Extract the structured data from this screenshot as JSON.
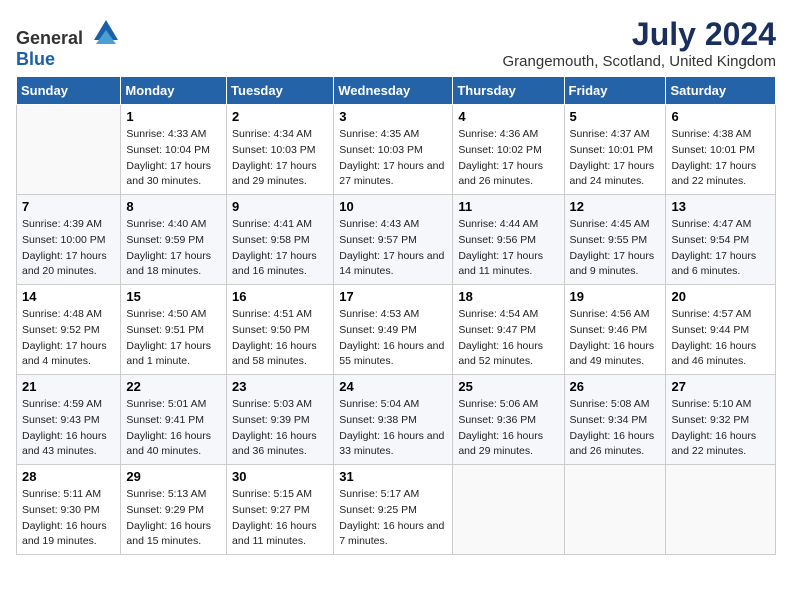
{
  "logo": {
    "general": "General",
    "blue": "Blue"
  },
  "title": "July 2024",
  "location": "Grangemouth, Scotland, United Kingdom",
  "headers": [
    "Sunday",
    "Monday",
    "Tuesday",
    "Wednesday",
    "Thursday",
    "Friday",
    "Saturday"
  ],
  "weeks": [
    [
      {
        "day": "",
        "sunrise": "",
        "sunset": "",
        "daylight": ""
      },
      {
        "day": "1",
        "sunrise": "Sunrise: 4:33 AM",
        "sunset": "Sunset: 10:04 PM",
        "daylight": "Daylight: 17 hours and 30 minutes."
      },
      {
        "day": "2",
        "sunrise": "Sunrise: 4:34 AM",
        "sunset": "Sunset: 10:03 PM",
        "daylight": "Daylight: 17 hours and 29 minutes."
      },
      {
        "day": "3",
        "sunrise": "Sunrise: 4:35 AM",
        "sunset": "Sunset: 10:03 PM",
        "daylight": "Daylight: 17 hours and 27 minutes."
      },
      {
        "day": "4",
        "sunrise": "Sunrise: 4:36 AM",
        "sunset": "Sunset: 10:02 PM",
        "daylight": "Daylight: 17 hours and 26 minutes."
      },
      {
        "day": "5",
        "sunrise": "Sunrise: 4:37 AM",
        "sunset": "Sunset: 10:01 PM",
        "daylight": "Daylight: 17 hours and 24 minutes."
      },
      {
        "day": "6",
        "sunrise": "Sunrise: 4:38 AM",
        "sunset": "Sunset: 10:01 PM",
        "daylight": "Daylight: 17 hours and 22 minutes."
      }
    ],
    [
      {
        "day": "7",
        "sunrise": "Sunrise: 4:39 AM",
        "sunset": "Sunset: 10:00 PM",
        "daylight": "Daylight: 17 hours and 20 minutes."
      },
      {
        "day": "8",
        "sunrise": "Sunrise: 4:40 AM",
        "sunset": "Sunset: 9:59 PM",
        "daylight": "Daylight: 17 hours and 18 minutes."
      },
      {
        "day": "9",
        "sunrise": "Sunrise: 4:41 AM",
        "sunset": "Sunset: 9:58 PM",
        "daylight": "Daylight: 17 hours and 16 minutes."
      },
      {
        "day": "10",
        "sunrise": "Sunrise: 4:43 AM",
        "sunset": "Sunset: 9:57 PM",
        "daylight": "Daylight: 17 hours and 14 minutes."
      },
      {
        "day": "11",
        "sunrise": "Sunrise: 4:44 AM",
        "sunset": "Sunset: 9:56 PM",
        "daylight": "Daylight: 17 hours and 11 minutes."
      },
      {
        "day": "12",
        "sunrise": "Sunrise: 4:45 AM",
        "sunset": "Sunset: 9:55 PM",
        "daylight": "Daylight: 17 hours and 9 minutes."
      },
      {
        "day": "13",
        "sunrise": "Sunrise: 4:47 AM",
        "sunset": "Sunset: 9:54 PM",
        "daylight": "Daylight: 17 hours and 6 minutes."
      }
    ],
    [
      {
        "day": "14",
        "sunrise": "Sunrise: 4:48 AM",
        "sunset": "Sunset: 9:52 PM",
        "daylight": "Daylight: 17 hours and 4 minutes."
      },
      {
        "day": "15",
        "sunrise": "Sunrise: 4:50 AM",
        "sunset": "Sunset: 9:51 PM",
        "daylight": "Daylight: 17 hours and 1 minute."
      },
      {
        "day": "16",
        "sunrise": "Sunrise: 4:51 AM",
        "sunset": "Sunset: 9:50 PM",
        "daylight": "Daylight: 16 hours and 58 minutes."
      },
      {
        "day": "17",
        "sunrise": "Sunrise: 4:53 AM",
        "sunset": "Sunset: 9:49 PM",
        "daylight": "Daylight: 16 hours and 55 minutes."
      },
      {
        "day": "18",
        "sunrise": "Sunrise: 4:54 AM",
        "sunset": "Sunset: 9:47 PM",
        "daylight": "Daylight: 16 hours and 52 minutes."
      },
      {
        "day": "19",
        "sunrise": "Sunrise: 4:56 AM",
        "sunset": "Sunset: 9:46 PM",
        "daylight": "Daylight: 16 hours and 49 minutes."
      },
      {
        "day": "20",
        "sunrise": "Sunrise: 4:57 AM",
        "sunset": "Sunset: 9:44 PM",
        "daylight": "Daylight: 16 hours and 46 minutes."
      }
    ],
    [
      {
        "day": "21",
        "sunrise": "Sunrise: 4:59 AM",
        "sunset": "Sunset: 9:43 PM",
        "daylight": "Daylight: 16 hours and 43 minutes."
      },
      {
        "day": "22",
        "sunrise": "Sunrise: 5:01 AM",
        "sunset": "Sunset: 9:41 PM",
        "daylight": "Daylight: 16 hours and 40 minutes."
      },
      {
        "day": "23",
        "sunrise": "Sunrise: 5:03 AM",
        "sunset": "Sunset: 9:39 PM",
        "daylight": "Daylight: 16 hours and 36 minutes."
      },
      {
        "day": "24",
        "sunrise": "Sunrise: 5:04 AM",
        "sunset": "Sunset: 9:38 PM",
        "daylight": "Daylight: 16 hours and 33 minutes."
      },
      {
        "day": "25",
        "sunrise": "Sunrise: 5:06 AM",
        "sunset": "Sunset: 9:36 PM",
        "daylight": "Daylight: 16 hours and 29 minutes."
      },
      {
        "day": "26",
        "sunrise": "Sunrise: 5:08 AM",
        "sunset": "Sunset: 9:34 PM",
        "daylight": "Daylight: 16 hours and 26 minutes."
      },
      {
        "day": "27",
        "sunrise": "Sunrise: 5:10 AM",
        "sunset": "Sunset: 9:32 PM",
        "daylight": "Daylight: 16 hours and 22 minutes."
      }
    ],
    [
      {
        "day": "28",
        "sunrise": "Sunrise: 5:11 AM",
        "sunset": "Sunset: 9:30 PM",
        "daylight": "Daylight: 16 hours and 19 minutes."
      },
      {
        "day": "29",
        "sunrise": "Sunrise: 5:13 AM",
        "sunset": "Sunset: 9:29 PM",
        "daylight": "Daylight: 16 hours and 15 minutes."
      },
      {
        "day": "30",
        "sunrise": "Sunrise: 5:15 AM",
        "sunset": "Sunset: 9:27 PM",
        "daylight": "Daylight: 16 hours and 11 minutes."
      },
      {
        "day": "31",
        "sunrise": "Sunrise: 5:17 AM",
        "sunset": "Sunset: 9:25 PM",
        "daylight": "Daylight: 16 hours and 7 minutes."
      },
      {
        "day": "",
        "sunrise": "",
        "sunset": "",
        "daylight": ""
      },
      {
        "day": "",
        "sunrise": "",
        "sunset": "",
        "daylight": ""
      },
      {
        "day": "",
        "sunrise": "",
        "sunset": "",
        "daylight": ""
      }
    ]
  ]
}
